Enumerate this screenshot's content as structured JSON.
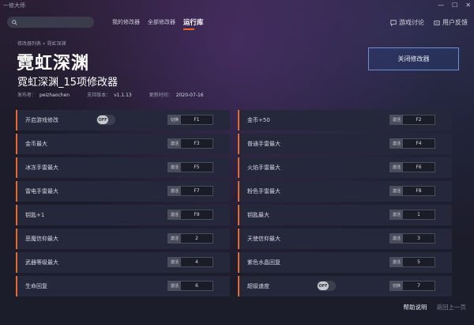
{
  "window": {
    "title": "一修大师",
    "minimize": "—",
    "maximize": "☐",
    "close": "✕"
  },
  "search": {
    "placeholder": ""
  },
  "nav": {
    "tabs": [
      "我的修改器",
      "全部修改器",
      "运行库"
    ],
    "active": "运行库"
  },
  "navright": {
    "forum": "游戏讨论",
    "feedback": "用户反馈"
  },
  "breadcrumb": "修改器列表 » 霓虹深渊",
  "game_title": "霓虹深渊",
  "trainer_title": "霓虹深渊_15项修改器",
  "meta": {
    "publisher_label": "发布者：",
    "publisher": "peizhaochen",
    "version_label": "支持版本：",
    "version": "v1.1.13",
    "updated_label": "更新时间：",
    "updated": "2020-07-16"
  },
  "close_button": "关闭修改器",
  "options": [
    {
      "left": {
        "label": "开启游戏修改",
        "toggle": "OFF",
        "kind": "切换",
        "key": "F1"
      },
      "right": {
        "label": "金币+50",
        "kind": "激活",
        "key": "F2"
      }
    },
    {
      "left": {
        "label": "金币最大",
        "kind": "激活",
        "key": "F3"
      },
      "right": {
        "label": "普通手雷最大",
        "kind": "激活",
        "key": "F4"
      }
    },
    {
      "left": {
        "label": "冰冻手雷最大",
        "kind": "激活",
        "key": "F5"
      },
      "right": {
        "label": "火焰手雷最大",
        "kind": "激活",
        "key": "F6"
      }
    },
    {
      "left": {
        "label": "雷电手雷最大",
        "kind": "激活",
        "key": "F7"
      },
      "right": {
        "label": "粉色手雷最大",
        "kind": "激活",
        "key": "F8"
      }
    },
    {
      "left": {
        "label": "钥匙+1",
        "kind": "激活",
        "key": "F9"
      },
      "right": {
        "label": "钥匙最大",
        "kind": "激活",
        "key": "1"
      }
    },
    {
      "left": {
        "label": "恶魔信仰最大",
        "kind": "激活",
        "key": "2"
      },
      "right": {
        "label": "天使信仰最大",
        "kind": "激活",
        "key": "3"
      }
    },
    {
      "left": {
        "label": "武器等级最大",
        "kind": "激活",
        "key": "4"
      },
      "right": {
        "label": "紫色水晶回复",
        "kind": "激活",
        "key": "5"
      }
    },
    {
      "left": {
        "label": "生命回复",
        "kind": "激活",
        "key": "6"
      },
      "right": {
        "label": "超级速度",
        "toggle": "OFF",
        "kind": "切换",
        "key": "7"
      }
    }
  ],
  "footer": {
    "help": "帮助说明",
    "back": "返回上一页"
  }
}
